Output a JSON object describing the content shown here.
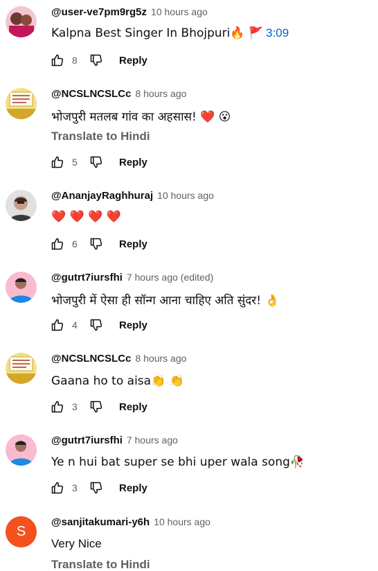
{
  "comments": [
    {
      "author": "@user-ve7pm9rg5z",
      "time": "10 hours ago",
      "text": "Kalpna Best Singer In Bhojpuri🔥 🚩",
      "timestamp_link": "3:09",
      "likes": "8",
      "reply_label": "Reply",
      "avatar_color": "#c2185b"
    },
    {
      "author": "@NCSLNCSLCc",
      "time": "8 hours ago",
      "text": "भोजपुरी मतलब गांव का अहसास! ❤️ 😮",
      "translate_label": "Translate to Hindi",
      "likes": "5",
      "reply_label": "Reply",
      "avatar_color": "#e6c65a"
    },
    {
      "author": "@AnanjayRaghhuraj",
      "time": "10 hours ago",
      "text": "❤️ ❤️ ❤️ ❤️",
      "likes": "6",
      "reply_label": "Reply",
      "avatar_color": "#9e9e9e"
    },
    {
      "author": "@gutrt7iursfhi",
      "time": "7 hours ago (edited)",
      "text": "भोजपुरी में ऐसा ही सॉन्ग आना चाहिए अति सुंदर! 👌",
      "likes": "4",
      "reply_label": "Reply",
      "avatar_color": "#d81b60"
    },
    {
      "author": "@NCSLNCSLCc",
      "time": "8 hours ago",
      "text": "Gaana ho to aisa👏 👏",
      "likes": "3",
      "reply_label": "Reply",
      "avatar_color": "#e6c65a"
    },
    {
      "author": "@gutrt7iursfhi",
      "time": "7 hours ago",
      "text": "Ye n hui bat super se bhi uper wala song🥀",
      "likes": "3",
      "reply_label": "Reply",
      "avatar_color": "#d81b60"
    },
    {
      "author": "@sanjitakumari-y6h",
      "time": "10 hours ago",
      "text": "Very Nice",
      "translate_label": "Translate to Hindi",
      "avatar_letter": "S",
      "avatar_color": "#f4511e"
    }
  ]
}
